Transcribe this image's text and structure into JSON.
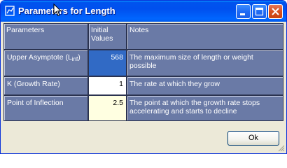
{
  "window": {
    "title": "Parameters for Length",
    "icon": "app-icon",
    "controls": [
      "minimize-icon",
      "maximize-icon",
      "close-icon"
    ]
  },
  "grid": {
    "headers": {
      "parameters": "Parameters",
      "initial_values_line1": "Initial",
      "initial_values_line2": "Values",
      "notes": "Notes"
    },
    "rows": [
      {
        "label_main": "Upper Asymptote (L",
        "label_sub": "inf",
        "label_end": ")",
        "value": "568",
        "note": "The maximum size of length or weight possible",
        "selected": true
      },
      {
        "label": "K (Growth Rate)",
        "value": "1",
        "note": "The rate at which they grow"
      },
      {
        "label": "Point of Inflection",
        "value": "2.5",
        "note": "The point at which the growth rate stops accelerating and starts to decline"
      }
    ]
  },
  "buttons": {
    "ok_label": "Ok"
  },
  "colors": {
    "titlebar": "#0054e3",
    "grid_cell": "#6a7aa6",
    "selected_cell": "#316ac5",
    "window_bg": "#ece9d8"
  }
}
